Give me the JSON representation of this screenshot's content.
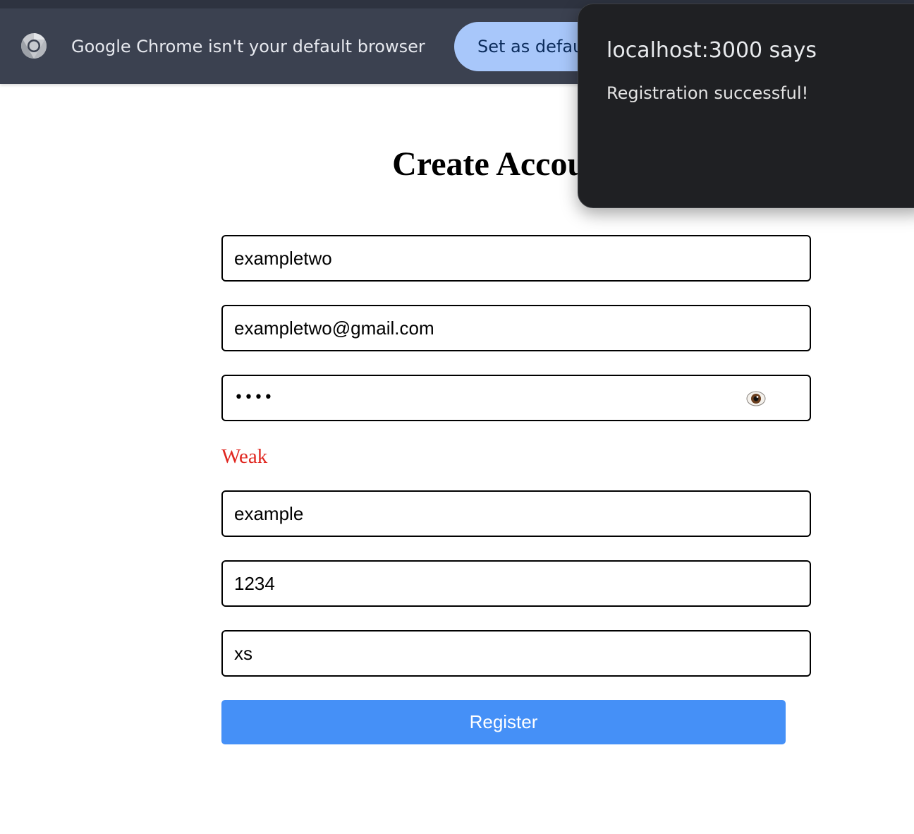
{
  "browser": {
    "infobar": {
      "message": "Google Chrome isn't your default browser",
      "set_default_label": "Set as default",
      "logo_icon": "chrome-logo-icon"
    }
  },
  "page": {
    "title": "Create Account",
    "fields": {
      "username": "exampletwo",
      "email": "exampletwo@gmail.com",
      "password_masked": "••••",
      "password_toggle_icon": "eye-icon",
      "strength": "Weak",
      "field4": "example",
      "field5": "1234",
      "field6": "xs"
    },
    "register_label": "Register"
  },
  "dialog": {
    "title": "localhost:3000 says",
    "message": "Registration successful!"
  },
  "colors": {
    "infobar_bg": "#3b4150",
    "pill_button": "#a8c7fa",
    "primary_button": "#4590f7",
    "strength_weak": "#e0261f",
    "dialog_bg": "#1f2023"
  }
}
